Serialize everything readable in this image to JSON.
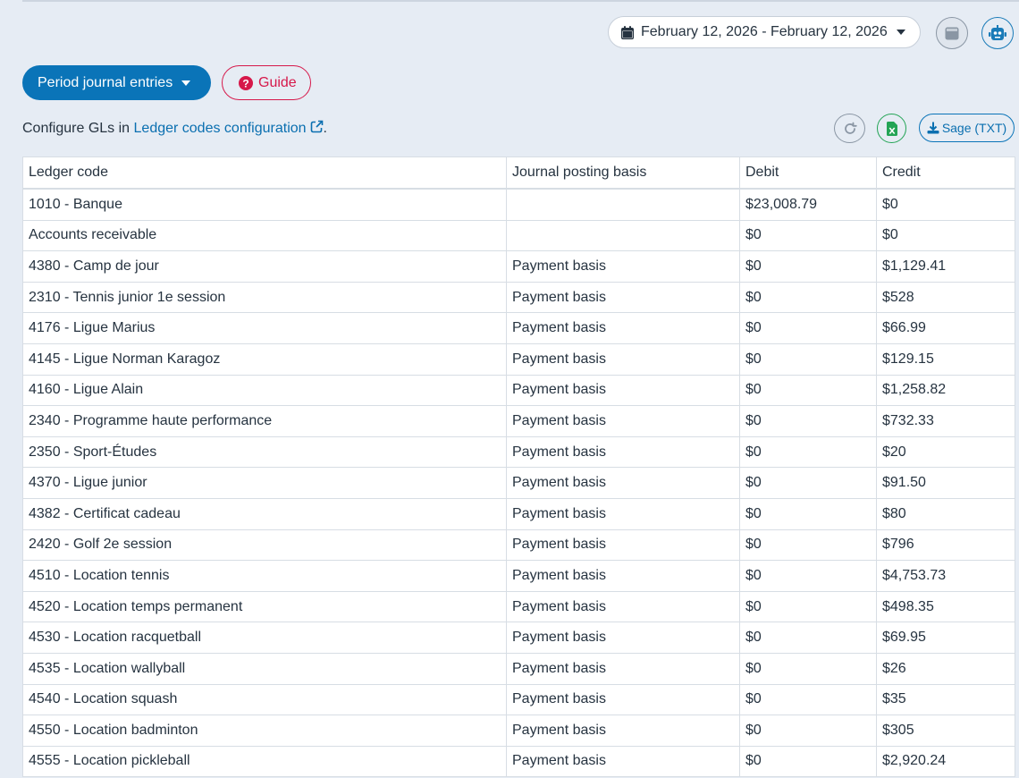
{
  "toolbar": {
    "date_range": "February 12, 2026 - February 12, 2026",
    "period_button": "Period journal entries",
    "guide_button": "Guide",
    "sage_button": "Sage (TXT)"
  },
  "config": {
    "prefix": "Configure GLs in ",
    "link": "Ledger codes configuration",
    "suffix": "."
  },
  "table": {
    "headers": [
      "Ledger code",
      "Journal posting basis",
      "Debit",
      "Credit"
    ],
    "rows": [
      [
        "1010 - Banque",
        "",
        "$23,008.79",
        "$0"
      ],
      [
        "Accounts receivable",
        "",
        "$0",
        "$0"
      ],
      [
        "4380 - Camp de jour",
        "Payment basis",
        "$0",
        "$1,129.41"
      ],
      [
        "2310 - Tennis junior 1e session",
        "Payment basis",
        "$0",
        "$528"
      ],
      [
        "4176 - Ligue Marius",
        "Payment basis",
        "$0",
        "$66.99"
      ],
      [
        "4145 - Ligue Norman Karagoz",
        "Payment basis",
        "$0",
        "$129.15"
      ],
      [
        "4160 - Ligue Alain",
        "Payment basis",
        "$0",
        "$1,258.82"
      ],
      [
        "2340 - Programme haute performance",
        "Payment basis",
        "$0",
        "$732.33"
      ],
      [
        "2350 - Sport-Études",
        "Payment basis",
        "$0",
        "$20"
      ],
      [
        "4370 - Ligue junior",
        "Payment basis",
        "$0",
        "$91.50"
      ],
      [
        "4382 - Certificat cadeau",
        "Payment basis",
        "$0",
        "$80"
      ],
      [
        "2420 - Golf 2e session",
        "Payment basis",
        "$0",
        "$796"
      ],
      [
        "4510 - Location tennis",
        "Payment basis",
        "$0",
        "$4,753.73"
      ],
      [
        "4520 - Location temps permanent",
        "Payment basis",
        "$0",
        "$498.35"
      ],
      [
        "4530 - Location racquetball",
        "Payment basis",
        "$0",
        "$69.95"
      ],
      [
        "4535 - Location wallyball",
        "Payment basis",
        "$0",
        "$26"
      ],
      [
        "4540 - Location squash",
        "Payment basis",
        "$0",
        "$35"
      ],
      [
        "4550 - Location badminton",
        "Payment basis",
        "$0",
        "$305"
      ],
      [
        "4555 - Location pickleball",
        "Payment basis",
        "$0",
        "$2,920.24"
      ]
    ]
  },
  "icons": {
    "date_range": "calendar-icon",
    "period_button": "caret-down-icon",
    "guide": "question-circle-icon",
    "grey_button": "window-icon",
    "robot_button": "robot-icon",
    "config_link": "external-link-icon",
    "refresh": "refresh-icon",
    "excel": "excel-icon",
    "sage": "download-icon"
  },
  "colors": {
    "background": "#e6ecf4",
    "primary": "#0a74b8",
    "link": "#0a6fb0",
    "guide": "#d6184a",
    "excel": "#23a455"
  }
}
